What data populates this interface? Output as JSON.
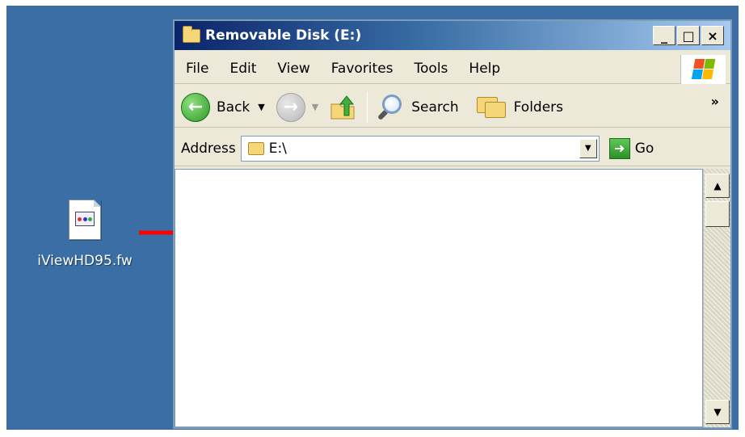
{
  "desktop": {
    "icon": {
      "name": "file-icon",
      "label": "iViewHD95.fw"
    }
  },
  "window": {
    "title": "Removable Disk (E:)",
    "controls": {
      "minimize": "_",
      "maximize": "□",
      "close": "×"
    },
    "menu": [
      "File",
      "Edit",
      "View",
      "Favorites",
      "Tools",
      "Help"
    ],
    "toolbar": {
      "back_label": "Back",
      "search_label": "Search",
      "folders_label": "Folders",
      "more": "»"
    },
    "address": {
      "label": "Address",
      "value": "E:\\",
      "go_label": "Go"
    }
  },
  "colors": {
    "desktop": "#3a6ea5",
    "arrow": "#ff0000",
    "title_gradient_start": "#0a246a"
  }
}
